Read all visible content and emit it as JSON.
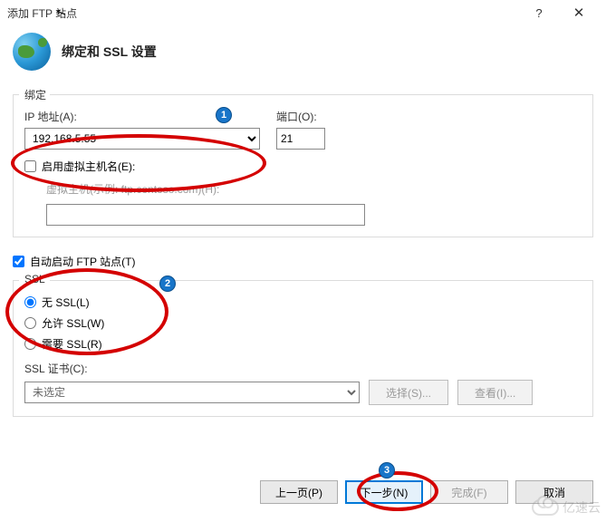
{
  "window": {
    "title": "添加 FTP 站点",
    "help": "?",
    "close": "✕"
  },
  "header": {
    "title": "绑定和 SSL 设置"
  },
  "binding": {
    "legend": "绑定",
    "ip_label": "IP 地址(A):",
    "ip_value": "192.168.5.55",
    "port_label": "端口(O):",
    "port_value": "21",
    "enable_vhost_label": "启用虚拟主机名(E):",
    "enable_vhost_checked": false,
    "vhost_label": "虚拟主机(示例: ftp.contoso.com)(H):",
    "vhost_value": ""
  },
  "autostart": {
    "label": "自动启动 FTP 站点(T)",
    "checked": true
  },
  "ssl": {
    "legend": "SSL",
    "options": [
      {
        "label": "无 SSL(L)",
        "value": "none",
        "checked": true
      },
      {
        "label": "允许 SSL(W)",
        "value": "allow",
        "checked": false
      },
      {
        "label": "需要 SSL(R)",
        "value": "require",
        "checked": false
      }
    ],
    "cert_label": "SSL 证书(C):",
    "cert_value": "未选定",
    "select_btn": "选择(S)...",
    "view_btn": "查看(I)..."
  },
  "footer": {
    "prev": "上一页(P)",
    "next": "下一步(N)",
    "finish": "完成(F)",
    "cancel": "取消"
  },
  "annotations": {
    "1": "1",
    "2": "2",
    "3": "3"
  },
  "watermark": "亿速云"
}
